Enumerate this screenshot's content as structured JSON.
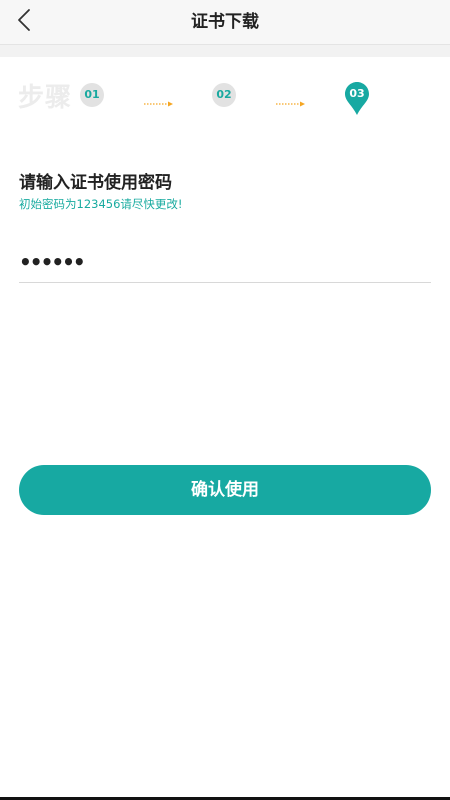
{
  "header": {
    "title": "证书下载",
    "back_icon": "chevron-left-icon"
  },
  "steps": {
    "label": "步骤",
    "items": [
      "01",
      "02",
      "03"
    ],
    "active_index": 3
  },
  "form": {
    "title": "请输入证书使用密码",
    "hint": "初始密码为123456请尽快更改!",
    "password_value": "••••••"
  },
  "actions": {
    "confirm_label": "确认使用"
  },
  "colors": {
    "accent": "#17a9a2",
    "arrow": "#f5a623",
    "step_inactive_bg": "#e2e2e2"
  }
}
